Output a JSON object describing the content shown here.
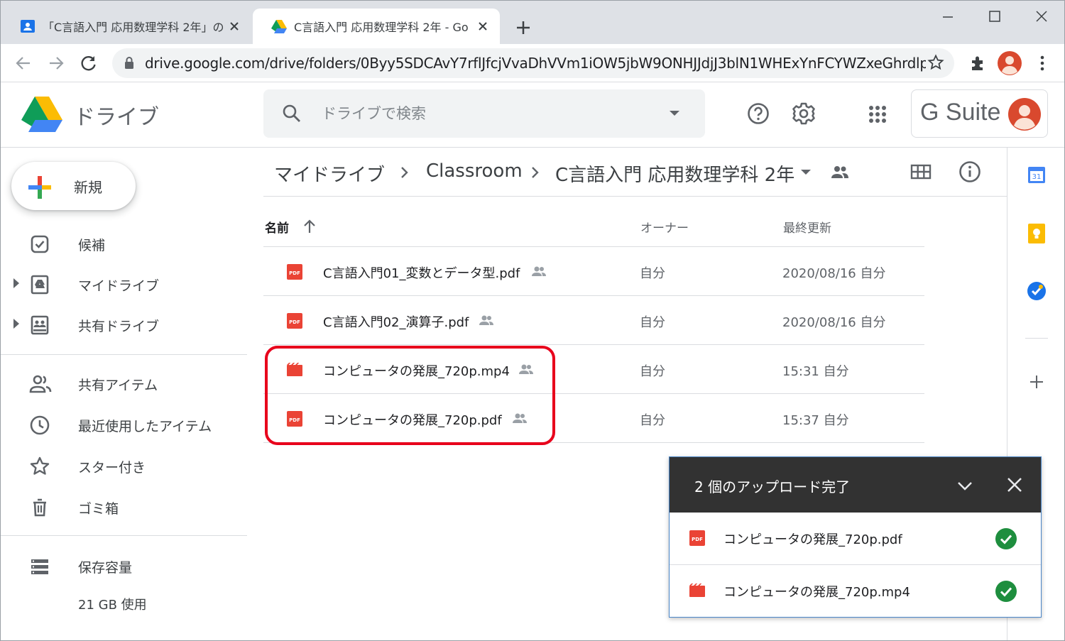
{
  "browser": {
    "tabs": [
      {
        "title": "「C言語入門 応用数理学科 2年」の",
        "active": false,
        "icon": "classroom-contact-icon"
      },
      {
        "title": "C言語入門 応用数理学科 2年 - Go",
        "active": true,
        "icon": "google-drive-icon"
      }
    ],
    "new_tab_label": "+",
    "url": "drive.google.com/drive/folders/0Byy5SDCAvY7rflJfcjVvaDhVVm1iOW5jbW9ONHJJdjJ3blN1WHExYnFCYWZxeGhrdlpURjA"
  },
  "drive": {
    "app_title": "ドライブ",
    "search_placeholder": "ドライブで検索",
    "gsuite_label": "G Suite",
    "new_button": "新規",
    "nav": [
      {
        "label": "候補",
        "icon": "priority-check-icon",
        "expandable": false
      },
      {
        "label": "マイドライブ",
        "icon": "my-drive-icon",
        "expandable": true
      },
      {
        "label": "共有ドライブ",
        "icon": "shared-drives-icon",
        "expandable": true
      },
      {
        "label": "共有アイテム",
        "icon": "people-icon",
        "expandable": false
      },
      {
        "label": "最近使用したアイテム",
        "icon": "clock-icon",
        "expandable": false
      },
      {
        "label": "スター付き",
        "icon": "star-icon",
        "expandable": false
      },
      {
        "label": "ゴミ箱",
        "icon": "trash-icon",
        "expandable": false
      },
      {
        "label": "保存容量",
        "icon": "storage-icon",
        "expandable": false
      }
    ],
    "storage_used": "21 GB 使用",
    "breadcrumb": [
      "マイドライブ",
      "Classroom",
      "C言語入門 応用数理学科 2年"
    ],
    "columns": {
      "name": "名前",
      "owner": "オーナー",
      "modified": "最終更新"
    },
    "files": [
      {
        "name": "C言語入門01_変数とデータ型.pdf",
        "type": "pdf",
        "shared": true,
        "owner": "自分",
        "modified": "2020/08/16 自分"
      },
      {
        "name": "C言語入門02_演算子.pdf",
        "type": "pdf",
        "shared": true,
        "owner": "自分",
        "modified": "2020/08/16 自分"
      },
      {
        "name": "コンピュータの発展_720p.mp4",
        "type": "video",
        "shared": true,
        "owner": "自分",
        "modified": "15:31 自分"
      },
      {
        "name": "コンピュータの発展_720p.pdf",
        "type": "pdf",
        "shared": true,
        "owner": "自分",
        "modified": "15:37 自分"
      }
    ],
    "upload_panel": {
      "title": "2 個のアップロード完了",
      "items": [
        {
          "name": "コンピュータの発展_720p.pdf",
          "type": "pdf",
          "status": "complete"
        },
        {
          "name": "コンピュータの発展_720p.mp4",
          "type": "video",
          "status": "complete"
        }
      ]
    },
    "colors": {
      "pdf": "#ea4335",
      "video": "#ea4335",
      "check": "#1e8e3e",
      "highlight": "#e8001c",
      "toast_header": "#323232"
    }
  }
}
